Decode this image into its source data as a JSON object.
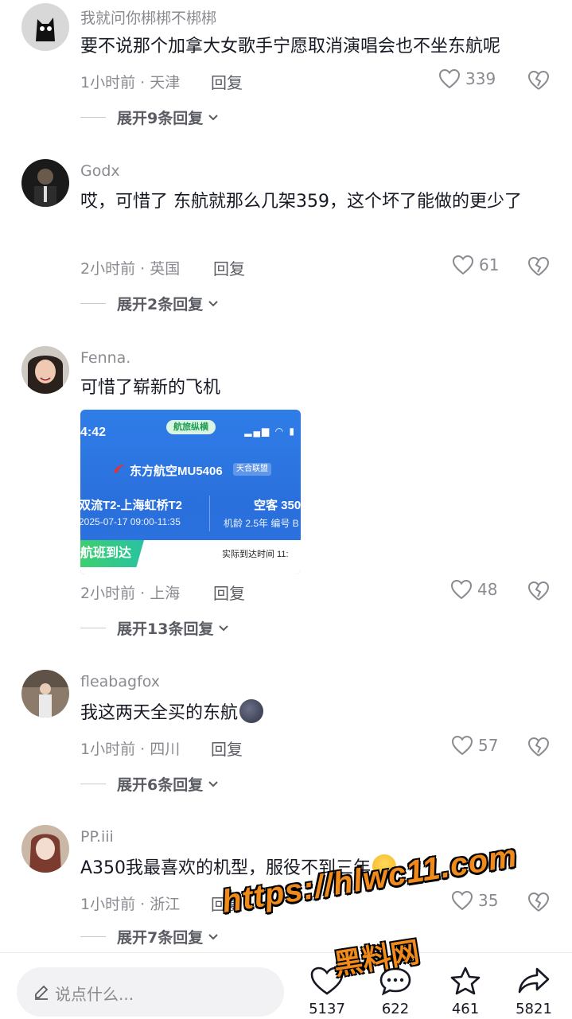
{
  "comments": [
    {
      "username": "我就问你梆梆不梆梆",
      "text": "要不说那个加拿大女歌手宁愿取消演唱会也不坐东航呢",
      "time": "1小时前 · 天津",
      "reply": "回复",
      "likes": "339",
      "expand": "展开9条回复"
    },
    {
      "username": "Godx",
      "text": "哎，可惜了 东航就那么几架359，这个坏了能做的更少了",
      "time": "2小时前 · 英国",
      "reply": "回复",
      "likes": "61",
      "expand": "展开2条回复"
    },
    {
      "username": "Fenna.",
      "text": "可惜了崭新的飞机",
      "time": "2小时前 · 上海",
      "reply": "回复",
      "likes": "48",
      "expand": "展开13条回复"
    },
    {
      "username": "fleabagfox",
      "text": "我这两天全买的东航",
      "time": "1小时前 · 四川",
      "reply": "回复",
      "likes": "57",
      "expand": "展开6条回复"
    },
    {
      "username": "PP.iii",
      "text": "A350我最喜欢的机型，服役不到三年",
      "time": "1小时前 · 浙江",
      "reply": "回复",
      "likes": "35",
      "expand": "展开7条回复"
    }
  ],
  "flight_card": {
    "clock": "4:42",
    "app": "航旅纵横",
    "airline": "东方航空MU5406",
    "alliance": "天合联盟",
    "route": "双流T2-上海虹桥T2",
    "date": "2025-07-17 09:00-11:35",
    "plane": "空客 350",
    "age": "机龄 2.5年 编号 B",
    "status": "航班到达",
    "actual": "实际到达时间 11:"
  },
  "bottom_bar": {
    "placeholder": "说点什么...",
    "likes": "5137",
    "comments": "622",
    "favorites": "461",
    "shares": "5821"
  },
  "watermark": {
    "url": "https://hlwc11.com",
    "name": "黑料网"
  },
  "colors": {
    "meta": "#8a8b91",
    "text": "#161823",
    "watermark": "#f08a1a",
    "card": "#2f7de8"
  }
}
